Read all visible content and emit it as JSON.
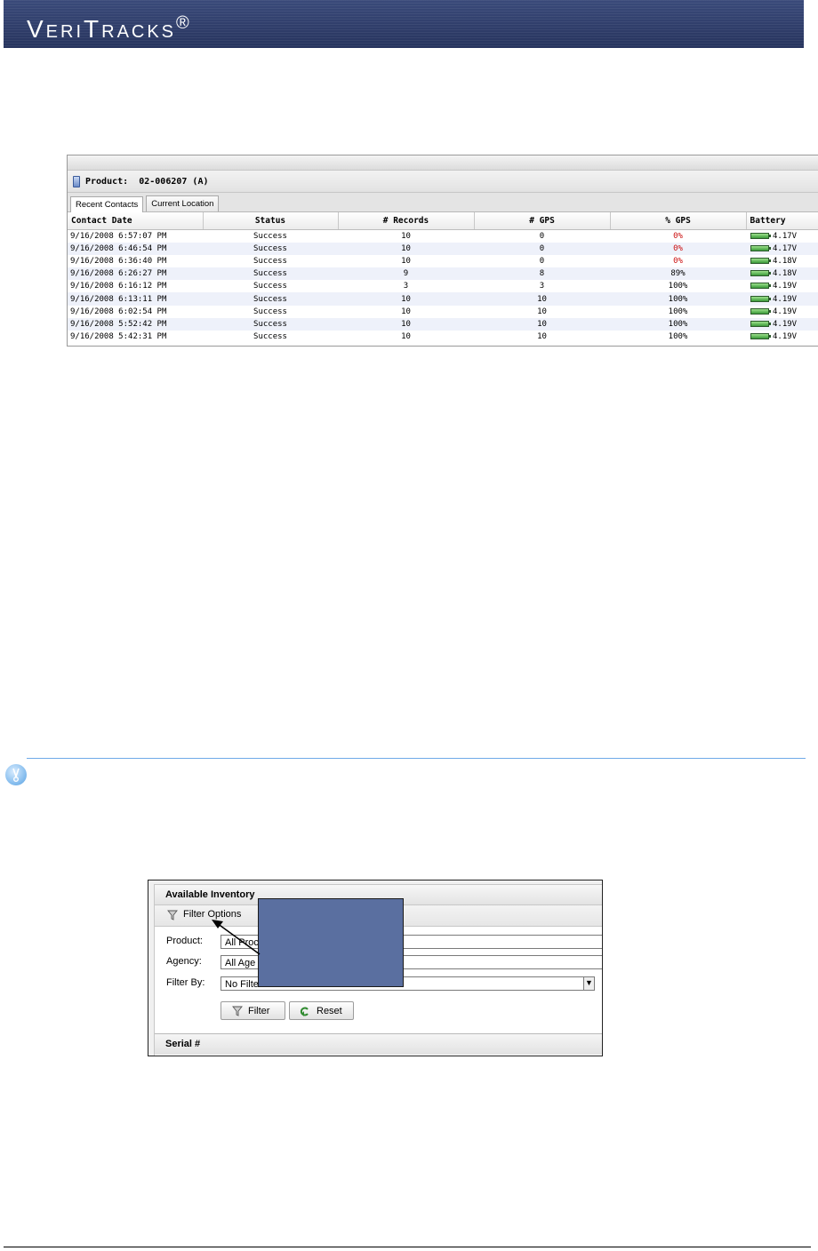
{
  "banner": {
    "logo_text": "VeriTracks",
    "logo_mark": "®",
    "bg_color": "#2d3a66"
  },
  "product_panel": {
    "product_label": "Product:",
    "product_value": "02-006207 (A)",
    "tabs": [
      {
        "label": "Recent Contacts",
        "active": true
      },
      {
        "label": "Current Location",
        "active": false
      }
    ],
    "columns": [
      "Contact Date",
      "Status",
      "# Records",
      "# GPS",
      "% GPS",
      "Battery"
    ],
    "rows": [
      {
        "date": "9/16/2008 6:57:07 PM",
        "status": "Success",
        "records": "10",
        "gps": "0",
        "pct": "0%",
        "pct_red": true,
        "battery": "4.17V"
      },
      {
        "date": "9/16/2008 6:46:54 PM",
        "status": "Success",
        "records": "10",
        "gps": "0",
        "pct": "0%",
        "pct_red": true,
        "battery": "4.17V"
      },
      {
        "date": "9/16/2008 6:36:40 PM",
        "status": "Success",
        "records": "10",
        "gps": "0",
        "pct": "0%",
        "pct_red": true,
        "battery": "4.18V"
      },
      {
        "date": "9/16/2008 6:26:27 PM",
        "status": "Success",
        "records": "9",
        "gps": "8",
        "pct": "89%",
        "pct_red": false,
        "battery": "4.18V"
      },
      {
        "date": "9/16/2008 6:16:12 PM",
        "status": "Success",
        "records": "3",
        "gps": "3",
        "pct": "100%",
        "pct_red": false,
        "battery": "4.19V"
      },
      {
        "date": "9/16/2008 6:13:11 PM",
        "status": "Success",
        "records": "10",
        "gps": "10",
        "pct": "100%",
        "pct_red": false,
        "battery": "4.19V"
      },
      {
        "date": "9/16/2008 6:02:54 PM",
        "status": "Success",
        "records": "10",
        "gps": "10",
        "pct": "100%",
        "pct_red": false,
        "battery": "4.19V"
      },
      {
        "date": "9/16/2008 5:52:42 PM",
        "status": "Success",
        "records": "10",
        "gps": "10",
        "pct": "100%",
        "pct_red": false,
        "battery": "4.19V"
      },
      {
        "date": "9/16/2008 5:42:31 PM",
        "status": "Success",
        "records": "10",
        "gps": "10",
        "pct": "100%",
        "pct_red": false,
        "battery": "4.19V"
      }
    ],
    "red_color": "#cc1111"
  },
  "note": {
    "icon": "lightbulb-icon",
    "line_color": "#6fa9e8"
  },
  "inventory_panel": {
    "title": "Available Inventory",
    "filter_options_label": "Filter Options",
    "product_label": "Product:",
    "product_value": "All Proc",
    "agency_label": "Agency:",
    "agency_value": "All Age",
    "filter_by_label": "Filter By:",
    "filter_by_value": "No Filter",
    "filter_button": "Filter",
    "reset_button": "Reset",
    "serial_header": "Serial #"
  },
  "callout": {
    "color": "#5a6fa0"
  }
}
